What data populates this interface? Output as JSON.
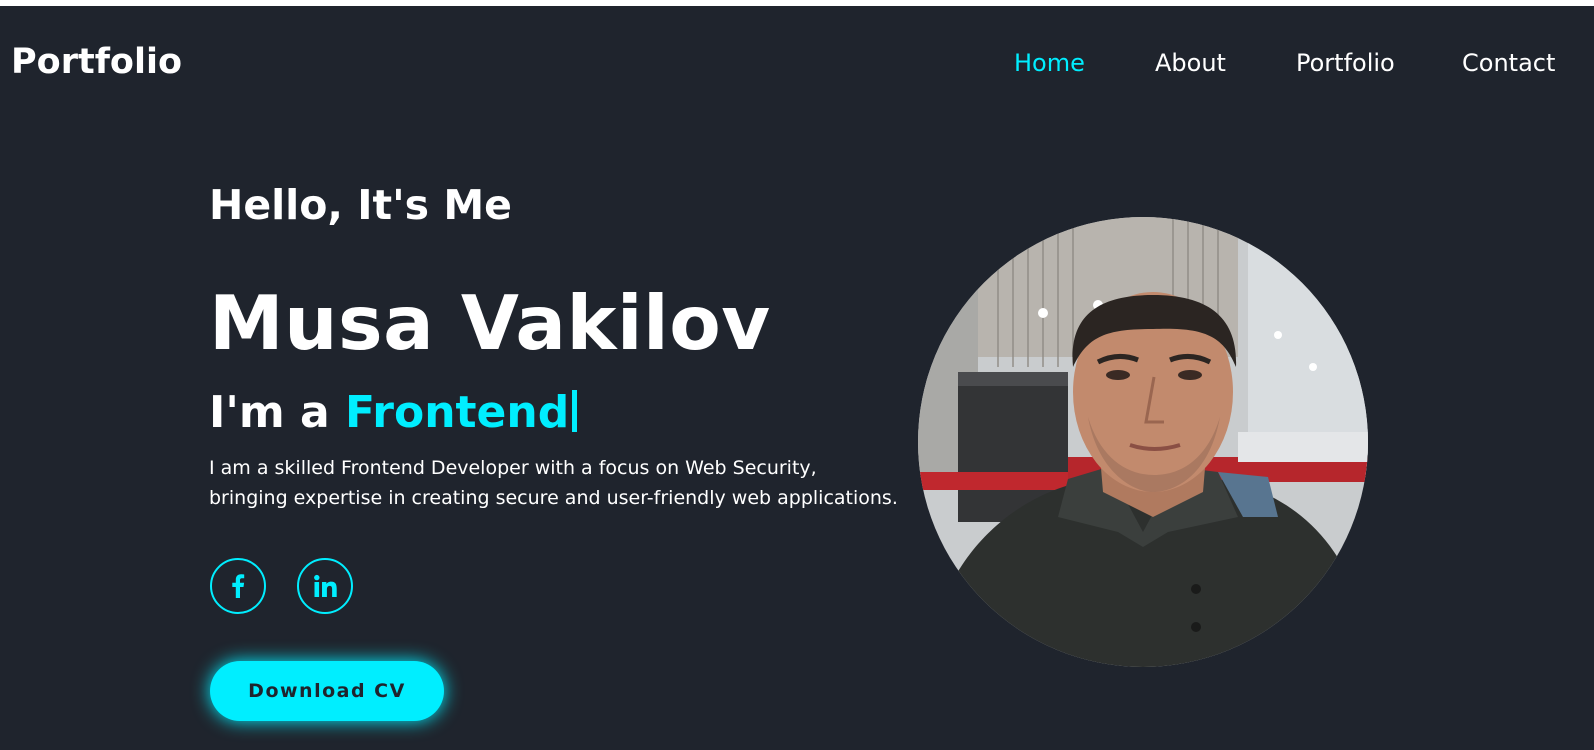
{
  "nav": {
    "logo": "Portfolio",
    "links": [
      {
        "label": "Home",
        "active": true
      },
      {
        "label": "About",
        "active": false
      },
      {
        "label": "Portfolio",
        "active": false
      },
      {
        "label": "Contact",
        "active": false
      }
    ]
  },
  "hero": {
    "greeting": "Hello, It's Me",
    "name": "Musa Vakilov",
    "role_prefix": "I'm a ",
    "role_typed": "Frontend",
    "description_line1": "I am a skilled Frontend Developer with a focus on Web Security,",
    "description_line2": "bringing expertise in creating secure and user-friendly web applications.",
    "socials": [
      {
        "icon": "facebook-icon",
        "glyph": "f"
      },
      {
        "icon": "linkedin-icon",
        "glyph": "in"
      }
    ],
    "cta_label": "Download CV",
    "photo_icon": "profile-photo"
  },
  "colors": {
    "background": "#1f242d",
    "accent": "#00eeff",
    "text": "#ffffff"
  }
}
